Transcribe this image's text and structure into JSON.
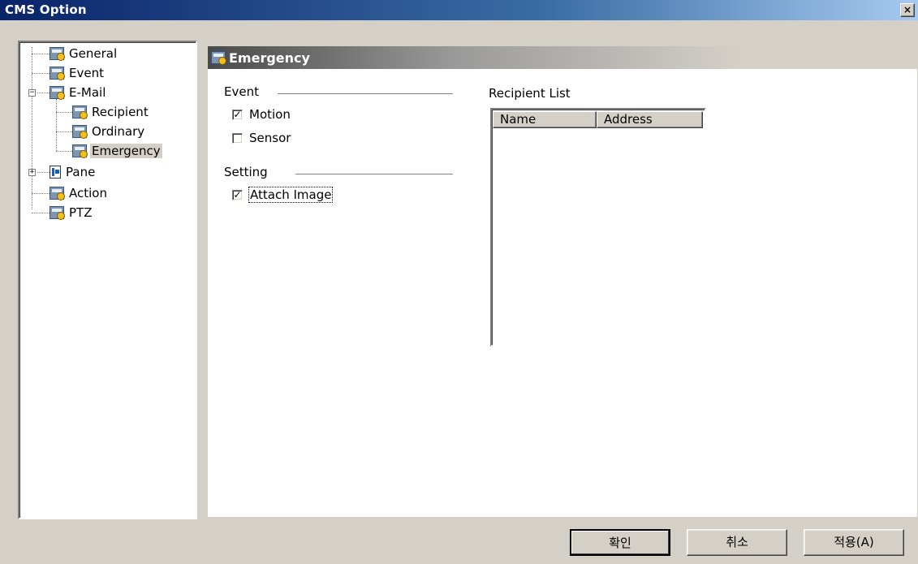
{
  "window": {
    "title": "CMS Option",
    "close_glyph": "×"
  },
  "tree": {
    "items": [
      {
        "label": "General"
      },
      {
        "label": "Event"
      },
      {
        "label": "E-Mail",
        "expander": "−"
      },
      {
        "label": "Recipient"
      },
      {
        "label": "Ordinary"
      },
      {
        "label": "Emergency",
        "selected": true
      },
      {
        "label": "Pane",
        "expander": "+"
      },
      {
        "label": "Action"
      },
      {
        "label": "PTZ"
      }
    ]
  },
  "panel": {
    "title": "Emergency",
    "event_group": {
      "label": "Event",
      "options": [
        {
          "label": "Motion",
          "checked": true
        },
        {
          "label": "Sensor",
          "checked": false
        }
      ]
    },
    "setting_group": {
      "label": "Setting",
      "options": [
        {
          "label": "Attach Image",
          "checked": true
        }
      ]
    },
    "recipient_list": {
      "label": "Recipient List",
      "columns": [
        "Name",
        "Address"
      ],
      "rows": []
    }
  },
  "buttons": {
    "ok": "확인",
    "cancel": "취소",
    "apply": "적용(A)"
  },
  "check_glyph": "✓"
}
